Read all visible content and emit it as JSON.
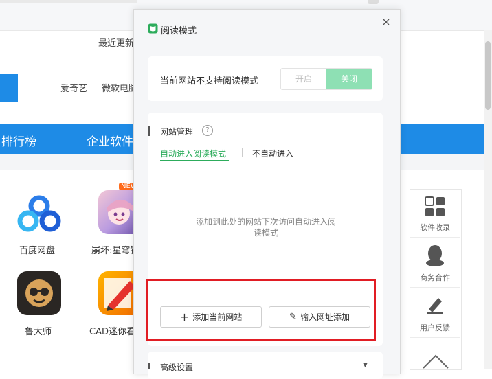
{
  "background_page": {
    "recent_text": "最近更新",
    "links": [
      "爱奇艺",
      "微软电脑管家"
    ],
    "nav_items": [
      "排行榜",
      "企业软件"
    ],
    "apps": [
      {
        "label": "百度网盘",
        "icon": "baidu-netdisk-icon"
      },
      {
        "label": "崩坏:星穹铁道",
        "icon": "game-character-icon",
        "badge": "NEW"
      },
      {
        "label": "鲁大师",
        "icon": "ludashi-monkey-icon"
      },
      {
        "label": "CAD迷你看图",
        "icon": "cad-pencil-icon"
      }
    ],
    "side_panel": [
      {
        "label": "软件收录",
        "icon": "grid-icon"
      },
      {
        "label": "商务合作",
        "icon": "penguin-icon"
      },
      {
        "label": "用户反馈",
        "icon": "pencil-icon"
      }
    ],
    "accent_color": "#1e8be6"
  },
  "reading_mode": {
    "title": "阅读模式",
    "close_label": "×",
    "status_text": "当前网站不支持阅读模式",
    "toggle": {
      "on_label": "开启",
      "off_label": "关闭",
      "selected": "关闭"
    },
    "site_management": {
      "title": "网站管理",
      "help_label": "?",
      "tabs": [
        {
          "label": "自动进入阅读模式",
          "active": true
        },
        {
          "label": "不自动进入",
          "active": false
        }
      ],
      "empty_hint": "添加到此处的网站下次访问自动进入阅读模式",
      "add_current_button": "添加当前网站",
      "input_url_button": "输入网址添加"
    },
    "advanced_settings": "高级设置",
    "accent_color": "#2dac5c",
    "highlight_color": "#e11d24"
  }
}
